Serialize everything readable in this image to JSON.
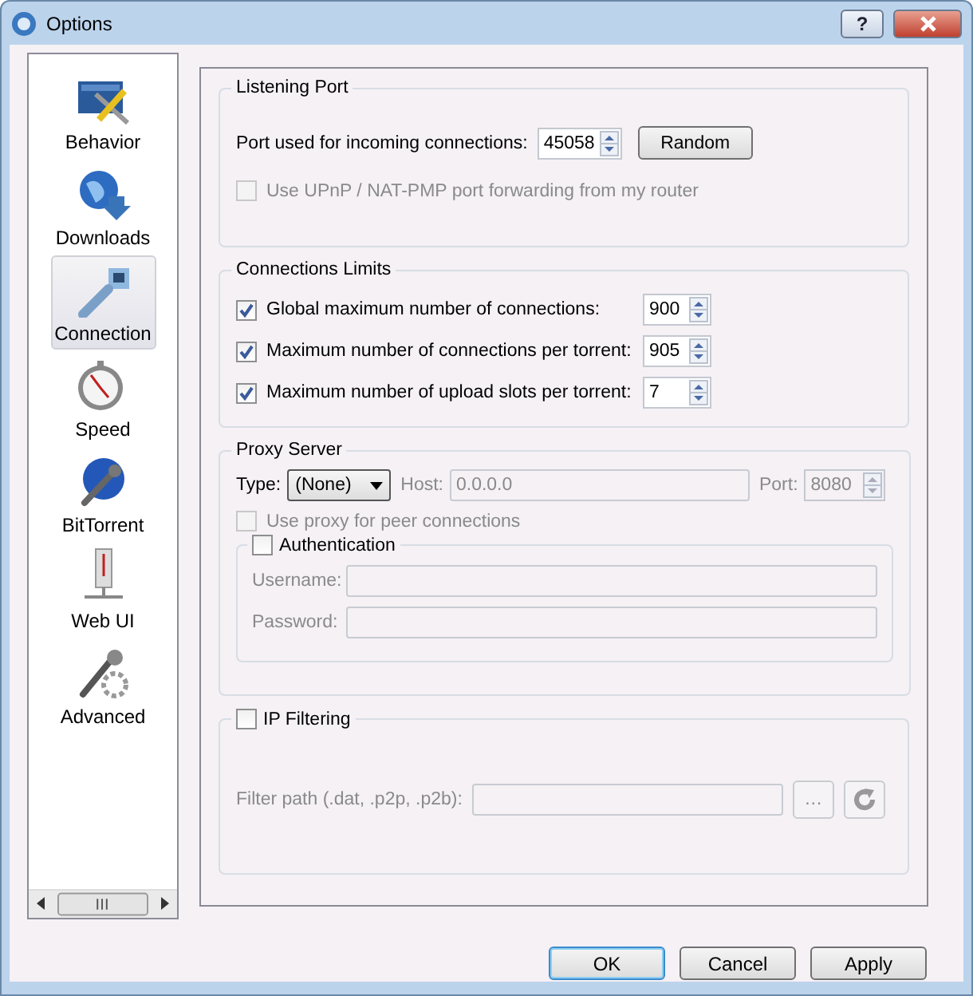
{
  "window": {
    "title": "Options",
    "help_button": "?"
  },
  "sidebar": {
    "items": [
      {
        "label": "Behavior",
        "kind": "behavior",
        "selected": false
      },
      {
        "label": "Downloads",
        "kind": "downloads",
        "selected": false
      },
      {
        "label": "Connection",
        "kind": "connection",
        "selected": true
      },
      {
        "label": "Speed",
        "kind": "speed",
        "selected": false
      },
      {
        "label": "BitTorrent",
        "kind": "bittorrent",
        "selected": false
      },
      {
        "label": "Web UI",
        "kind": "webui",
        "selected": false
      },
      {
        "label": "Advanced",
        "kind": "advanced",
        "selected": false
      }
    ]
  },
  "listening_port": {
    "title": "Listening Port",
    "port_label": "Port used for incoming connections:",
    "port_value": "45058",
    "random_button": "Random",
    "upnp": {
      "label": "Use UPnP / NAT-PMP port forwarding from my router",
      "checked": false,
      "disabled": true
    }
  },
  "connections_limits": {
    "title": "Connections Limits",
    "rows": [
      {
        "label": "Global maximum number of connections:",
        "checked": true,
        "value": "900"
      },
      {
        "label": "Maximum number of connections per torrent:",
        "checked": true,
        "value": "905"
      },
      {
        "label": "Maximum number of upload slots per torrent:",
        "checked": true,
        "value": "7"
      }
    ]
  },
  "proxy_server": {
    "title": "Proxy Server",
    "type_label": "Type:",
    "type_value": "(None)",
    "host_label": "Host:",
    "host_value": "0.0.0.0",
    "port_label": "Port:",
    "port_value": "8080",
    "disabled": true,
    "peer": {
      "label": "Use proxy for peer connections",
      "checked": false,
      "disabled": true
    },
    "authentication": {
      "label": "Authentication",
      "checked": false,
      "fields": [
        {
          "label": "Username:"
        },
        {
          "label": "Password:"
        }
      ]
    }
  },
  "ip_filtering": {
    "label": "IP Filtering",
    "checked": false,
    "path_label": "Filter path (.dat, .p2p, .p2b):",
    "browse_button": "…"
  },
  "buttons": [
    {
      "label": "OK",
      "default": true
    },
    {
      "label": "Cancel",
      "default": false
    },
    {
      "label": "Apply",
      "default": false
    }
  ]
}
